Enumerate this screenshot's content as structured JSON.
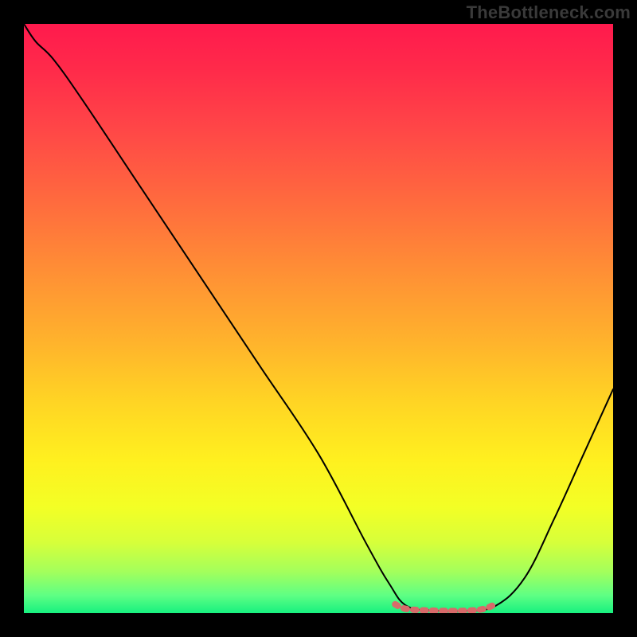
{
  "watermark": "TheBottleneck.com",
  "chart_data": {
    "type": "line",
    "title": "",
    "xlabel": "",
    "ylabel": "",
    "xlim": [
      0,
      100
    ],
    "ylim": [
      0,
      100
    ],
    "grid": false,
    "series": [
      {
        "name": "bottleneck-curve",
        "color": "#000000",
        "points": [
          {
            "x": 0,
            "y": 100
          },
          {
            "x": 2,
            "y": 97
          },
          {
            "x": 5,
            "y": 94
          },
          {
            "x": 10,
            "y": 87
          },
          {
            "x": 20,
            "y": 72
          },
          {
            "x": 30,
            "y": 57
          },
          {
            "x": 40,
            "y": 42
          },
          {
            "x": 50,
            "y": 27
          },
          {
            "x": 58,
            "y": 12
          },
          {
            "x": 62,
            "y": 5
          },
          {
            "x": 65,
            "y": 1.2
          },
          {
            "x": 70,
            "y": 0.4
          },
          {
            "x": 75,
            "y": 0.4
          },
          {
            "x": 80,
            "y": 1.2
          },
          {
            "x": 85,
            "y": 6
          },
          {
            "x": 90,
            "y": 16
          },
          {
            "x": 95,
            "y": 27
          },
          {
            "x": 100,
            "y": 38
          }
        ]
      },
      {
        "name": "flat-highlight",
        "color": "#d86a6a",
        "stroke_width": 8,
        "points": [
          {
            "x": 63,
            "y": 1.5
          },
          {
            "x": 65,
            "y": 0.7
          },
          {
            "x": 70,
            "y": 0.4
          },
          {
            "x": 75,
            "y": 0.4
          },
          {
            "x": 78,
            "y": 0.7
          },
          {
            "x": 80,
            "y": 1.5
          }
        ]
      }
    ]
  }
}
